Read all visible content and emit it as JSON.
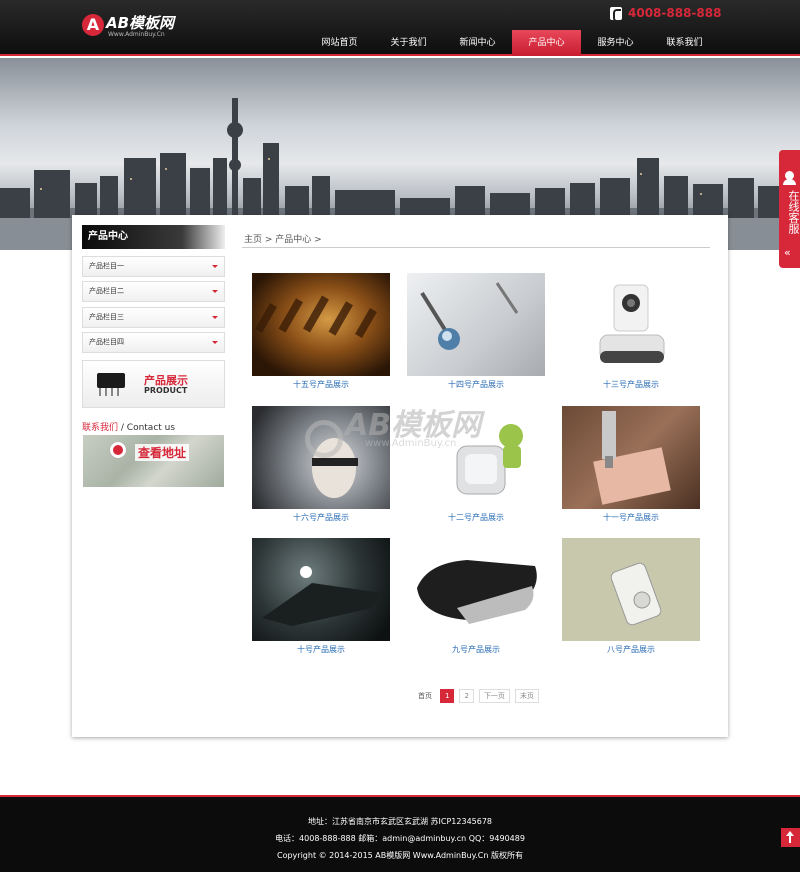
{
  "header": {
    "logo_mark": "A",
    "logo_name": "AB模板网",
    "logo_sub": "Www.AdminBuy.Cn",
    "phone_icon": "phone-icon",
    "phone": "4008-888-888",
    "nav": [
      "网站首页",
      "关于我们",
      "新闻中心",
      "产品中心",
      "服务中心",
      "联系我们"
    ],
    "active_nav": "产品中心"
  },
  "sidebar": {
    "title": "产品中心",
    "items": [
      "产品栏目一",
      "产品栏目二",
      "产品栏目三",
      "产品栏目四"
    ],
    "promo_cn": "产品展示",
    "promo_en": "PRODUCT",
    "contact_cn": "联系我们",
    "contact_sep": " / ",
    "contact_en": "Contact us",
    "map_text": "查看地址"
  },
  "breadcrumb": "主页 > 产品中心 >",
  "products": [
    "十五号产品展示",
    "十四号产品展示",
    "十三号产品展示",
    "十六号产品展示",
    "十二号产品展示",
    "十一号产品展示",
    "十号产品展示",
    "九号产品展示",
    "八号产品展示"
  ],
  "watermark": {
    "brand": "AB模板网",
    "url": "www.AdminBuy.cn"
  },
  "pager": {
    "first": "首页",
    "pages": [
      "1",
      "2"
    ],
    "current": "1",
    "next": "下一页",
    "last": "末页"
  },
  "float_service": {
    "label": "在线客服",
    "arrow": "«"
  },
  "footer": {
    "line1": "地址：江苏省南京市玄武区玄武湖   苏ICP12345678",
    "line2": "电话：4008-888-888    邮箱：admin@adminbuy.cn    QQ：9490489",
    "line3": "Copyright © 2014-2015 AB模版网 Www.AdminBuy.Cn 版权所有"
  },
  "colors": {
    "accent": "#d7283a",
    "link": "#2a6db5",
    "header_bg": "#111111"
  }
}
